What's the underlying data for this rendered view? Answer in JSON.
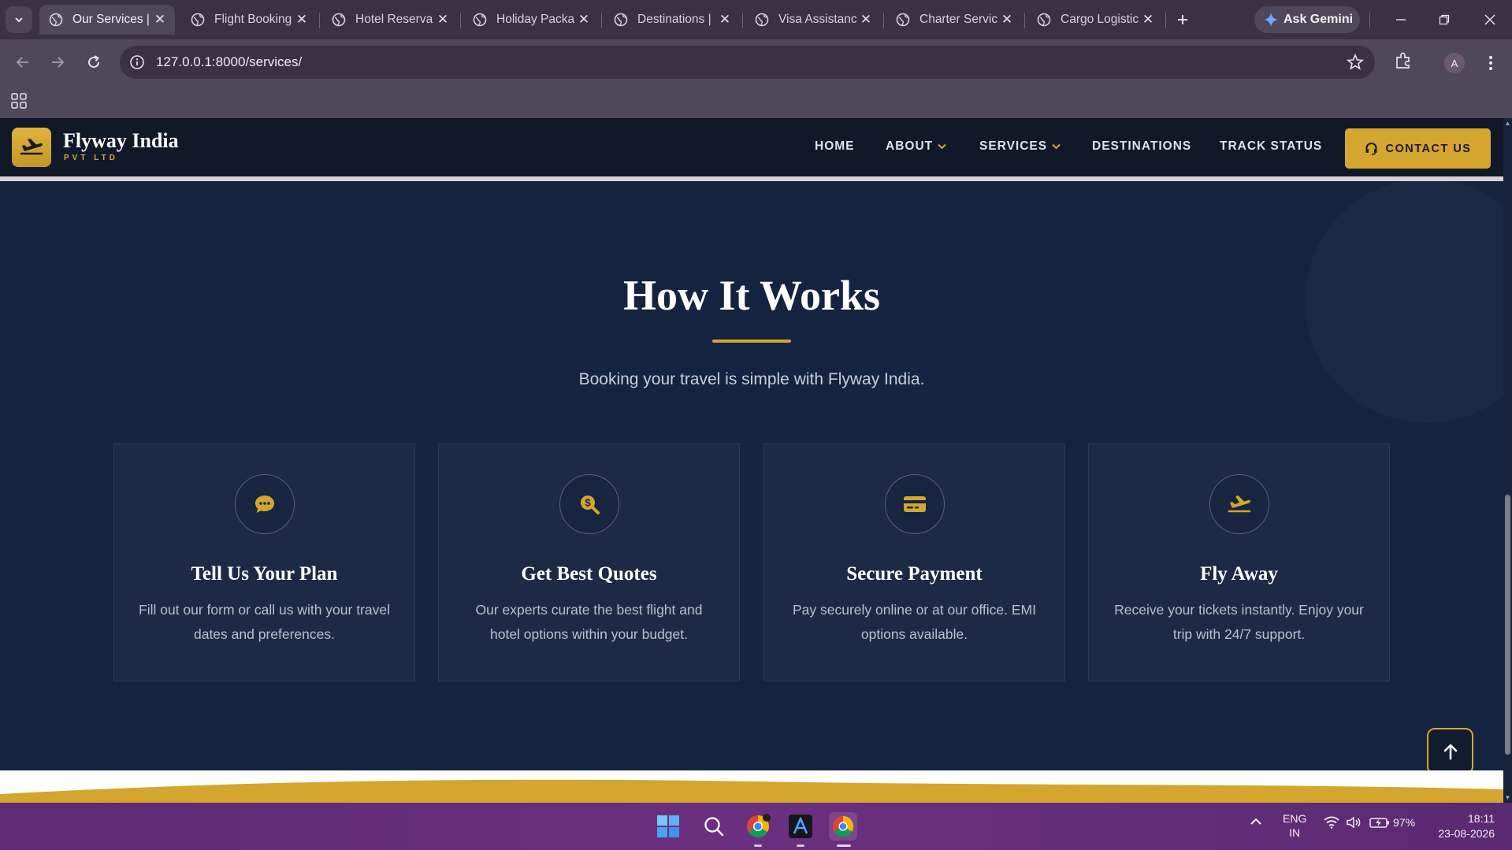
{
  "browser": {
    "tabs": [
      {
        "label": "Our Services |",
        "active": true
      },
      {
        "label": "Flight Booking",
        "active": false
      },
      {
        "label": "Hotel Reserva",
        "active": false
      },
      {
        "label": "Holiday Packa",
        "active": false
      },
      {
        "label": "Destinations |",
        "active": false
      },
      {
        "label": "Visa Assistanc",
        "active": false
      },
      {
        "label": "Charter Servic",
        "active": false
      },
      {
        "label": "Cargo Logistic",
        "active": false
      }
    ],
    "gemini_label": "Ask Gemini",
    "url": "127.0.0.1:8000/services/",
    "profile_initial": "A"
  },
  "site": {
    "brand": "Flyway India",
    "brand_sub": "PVT LTD",
    "nav": {
      "home": "HOME",
      "about": "ABOUT",
      "services": "SERVICES",
      "destinations": "DESTINATIONS",
      "track": "TRACK STATUS"
    },
    "contact_label": "CONTACT US",
    "accent": "#d4a62f",
    "background": "#142340"
  },
  "section": {
    "title": "How It Works",
    "subtitle": "Booking your travel is simple with Flyway India.",
    "steps": [
      {
        "icon": "chat-icon",
        "title": "Tell Us Your Plan",
        "text": "Fill out our form or call us with your travel dates and preferences."
      },
      {
        "icon": "search-dollar-icon",
        "title": "Get Best Quotes",
        "text": "Our experts curate the best flight and hotel options within your budget."
      },
      {
        "icon": "credit-card-icon",
        "title": "Secure Payment",
        "text": "Pay securely online or at our office. EMI options available."
      },
      {
        "icon": "plane-departure-icon",
        "title": "Fly Away",
        "text": "Receive your tickets instantly. Enjoy your trip with 24/7 support."
      }
    ]
  },
  "taskbar": {
    "lang_top": "ENG",
    "lang_bottom": "IN",
    "battery": "97%",
    "time": "18:11",
    "date": "23-08-2026"
  }
}
